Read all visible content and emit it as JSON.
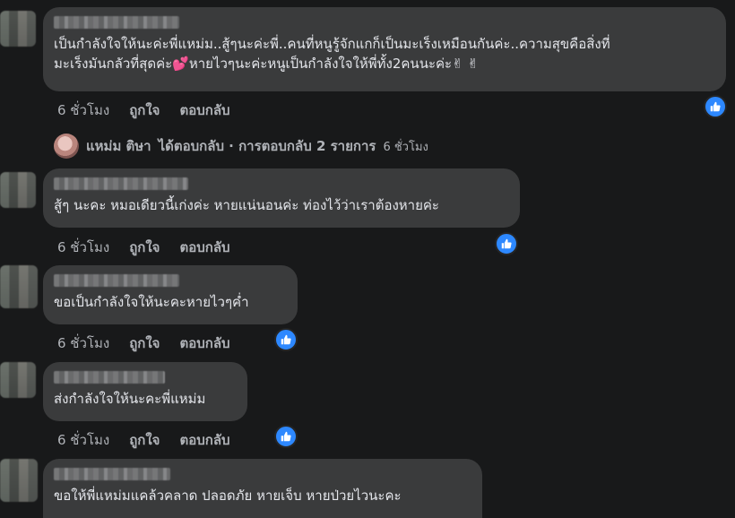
{
  "comments": [
    {
      "lines": [
        "เป็นกำลังใจให้นะค่ะพี่แหม่ม..สู้ๆนะค่ะพี่..คนที่หนูรู้จักแกก็เป็นมะเร็งเหมือนกันค่ะ..ความสุขคือสิ่งที่",
        "มะเร็งมันกลัวที่สุดค่ะ💕หายไวๆนะค่ะหนูเป็นกำลังใจให้พี่ทั้ง2คนนะค่ะ✌ ✌"
      ],
      "time": "6 ชั่วโมง",
      "like": "ถูกใจ",
      "reply": "ตอบกลับ"
    },
    {
      "lines": [
        "สู้ๆ นะคะ หมอเดียวนี้เก่งค่ะ หายแน่นอนค่ะ ท่องไว้ว่าเราต้องหายค่ะ"
      ],
      "time": "6 ชั่วโมง",
      "like": "ถูกใจ",
      "reply": "ตอบกลับ"
    },
    {
      "lines": [
        "ขอเป็นกำลังใจให้นะคะหายไวๆค่ำ"
      ],
      "time": "6 ชั่วโมง",
      "like": "ถูกใจ",
      "reply": "ตอบกลับ"
    },
    {
      "lines": [
        "ส่งกำลังใจให้นะคะพี่แหม่ม"
      ],
      "time": "6 ชั่วโมง",
      "like": "ถูกใจ",
      "reply": "ตอบกลับ"
    },
    {
      "lines": [
        "ขอให้พี่แหม่มแคล้วคลาด ปลอดภัย หายเจ็บ หายป่วยไวนะคะ"
      ]
    }
  ],
  "reply_summary": {
    "author": "แหม่ม ติษา",
    "text": "ได้ตอบกลับ · การตอบกลับ 2 รายการ",
    "time": "6 ชั่วโมง"
  },
  "icons": {
    "reaction": "like-icon",
    "avatar": "avatar-icon"
  },
  "colors": {
    "background": "#18191a",
    "bubble": "#3a3b3c",
    "like": "#2d88ff"
  }
}
